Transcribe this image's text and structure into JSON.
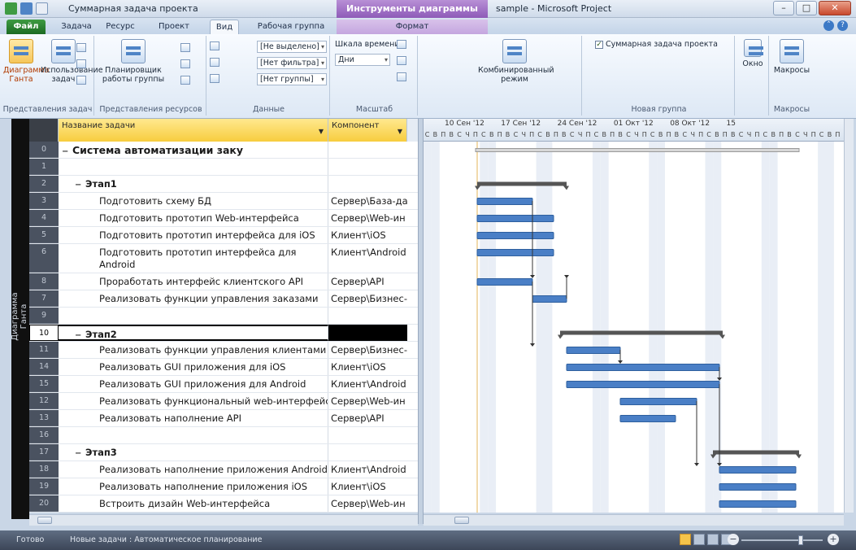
{
  "window": {
    "doc_title": "Суммарная задача проекта",
    "context_tab": "Инструменты диаграммы Ганта",
    "app_title": "sample - Microsoft Project",
    "minimize": "–",
    "maximize": "□",
    "close": "✕"
  },
  "tabs": {
    "file": "Файл",
    "task": "Задача",
    "resource": "Ресурс",
    "project": "Проект",
    "view": "Вид",
    "team": "Рабочая группа",
    "format": "Формат"
  },
  "ribbon": {
    "gantt_button": "Диаграмма Ганта",
    "task_usage_button": "Использование задач",
    "group_task_views": "Представления задач",
    "team_planner_button": "Планировщик работы группы",
    "group_resource_views": "Представления ресурсов",
    "highlight_value": "[Не выделено]",
    "filter_value": "[Нет фильтра]",
    "group_value": "[Нет группы]",
    "group_data": "Данные",
    "timescale_label": "Шкала времени:",
    "timescale_value": "Дни",
    "group_zoom": "Масштаб",
    "combined_button": "Комбинированный режим",
    "summary_task_checkbox": "Суммарная задача проекта",
    "group_new_group": "Новая группа",
    "window_button": "Окно",
    "macros_button": "Макросы",
    "group_macros": "Макросы"
  },
  "left_bar": {
    "label": "Диаграмма Ганта"
  },
  "grid": {
    "col_name": "Название задачи",
    "col_component": "Компонент",
    "rows": [
      {
        "id": "0",
        "name": "Система автоматизации заку",
        "component": "",
        "level": 0,
        "summary": true
      },
      {
        "id": "1",
        "name": "",
        "component": ""
      },
      {
        "id": "2",
        "name": "Этап1",
        "component": "",
        "summary": true
      },
      {
        "id": "3",
        "name": "Подготовить схему БД",
        "component": "Сервер\\База-да"
      },
      {
        "id": "4",
        "name": "Подготовить прототип Web-интерфейса",
        "component": "Сервер\\Web-ин"
      },
      {
        "id": "5",
        "name": "Подготовить прототип интерфейса для iOS",
        "component": "Клиент\\iOS"
      },
      {
        "id": "6",
        "name": "Подготовить прототип интерфейса для Android",
        "component": "Клиент\\Android"
      },
      {
        "id": "8",
        "name": "Проработать интерфейс клиентского API",
        "component": "Сервер\\API"
      },
      {
        "id": "7",
        "name": "Реализовать функции управления заказами",
        "component": "Сервер\\Бизнес-"
      },
      {
        "id": "9",
        "name": "",
        "component": ""
      },
      {
        "id": "10",
        "name": "Этап2",
        "component": "",
        "summary": true,
        "selected": true
      },
      {
        "id": "11",
        "name": "Реализовать функции управления клиентами",
        "component": "Сервер\\Бизнес-"
      },
      {
        "id": "14",
        "name": "Реализовать GUI приложения для iOS",
        "component": "Клиент\\iOS"
      },
      {
        "id": "15",
        "name": "Реализовать GUI приложения для Android",
        "component": "Клиент\\Android"
      },
      {
        "id": "12",
        "name": "Реализовать функциональный web-интерфейс",
        "component": "Сервер\\Web-ин"
      },
      {
        "id": "13",
        "name": "Реализовать наполнение API",
        "component": "Сервер\\API"
      },
      {
        "id": "16",
        "name": "",
        "component": ""
      },
      {
        "id": "17",
        "name": "Этап3",
        "component": "",
        "summary": true
      },
      {
        "id": "18",
        "name": "Реализовать наполнение приложения Android",
        "component": "Клиент\\Android"
      },
      {
        "id": "19",
        "name": "Реализовать наполнение приложения iOS",
        "component": "Клиент\\iOS"
      },
      {
        "id": "20",
        "name": "Встроить дизайн Web-интерфейса",
        "component": "Сервер\\Web-ин"
      }
    ]
  },
  "timescale": {
    "weeks": [
      "10 Сен '12",
      "17 Сен '12",
      "24 Сен '12",
      "01 Окт '12",
      "08 Окт '12",
      "15"
    ],
    "day_letters": [
      "С",
      "В",
      "П",
      "В",
      "С",
      "Ч",
      "П"
    ]
  },
  "gantt": {
    "colors": {
      "bar": "#4a7fc6",
      "summary": "#555555",
      "weekend": "#e9eef6",
      "today_line": "#e3b45a"
    },
    "bars": [
      {
        "row": 0,
        "type": "project"
      },
      {
        "row": 2,
        "type": "summary"
      },
      {
        "row": 3,
        "type": "task"
      },
      {
        "row": 4,
        "type": "task"
      },
      {
        "row": 5,
        "type": "task"
      },
      {
        "row": 6,
        "type": "task"
      },
      {
        "row": 7,
        "type": "task"
      },
      {
        "row": 8,
        "type": "task"
      },
      {
        "row": 10,
        "type": "summary"
      },
      {
        "row": 11,
        "type": "task"
      },
      {
        "row": 12,
        "type": "task"
      },
      {
        "row": 13,
        "type": "task"
      },
      {
        "row": 14,
        "type": "task"
      },
      {
        "row": 15,
        "type": "task"
      },
      {
        "row": 17,
        "type": "summary"
      },
      {
        "row": 18,
        "type": "task"
      },
      {
        "row": 19,
        "type": "task"
      },
      {
        "row": 20,
        "type": "task"
      }
    ]
  },
  "status": {
    "ready": "Готово",
    "new_tasks": "Новые задачи : Автоматическое планирование",
    "zoom_minus": "−",
    "zoom_plus": "+"
  }
}
